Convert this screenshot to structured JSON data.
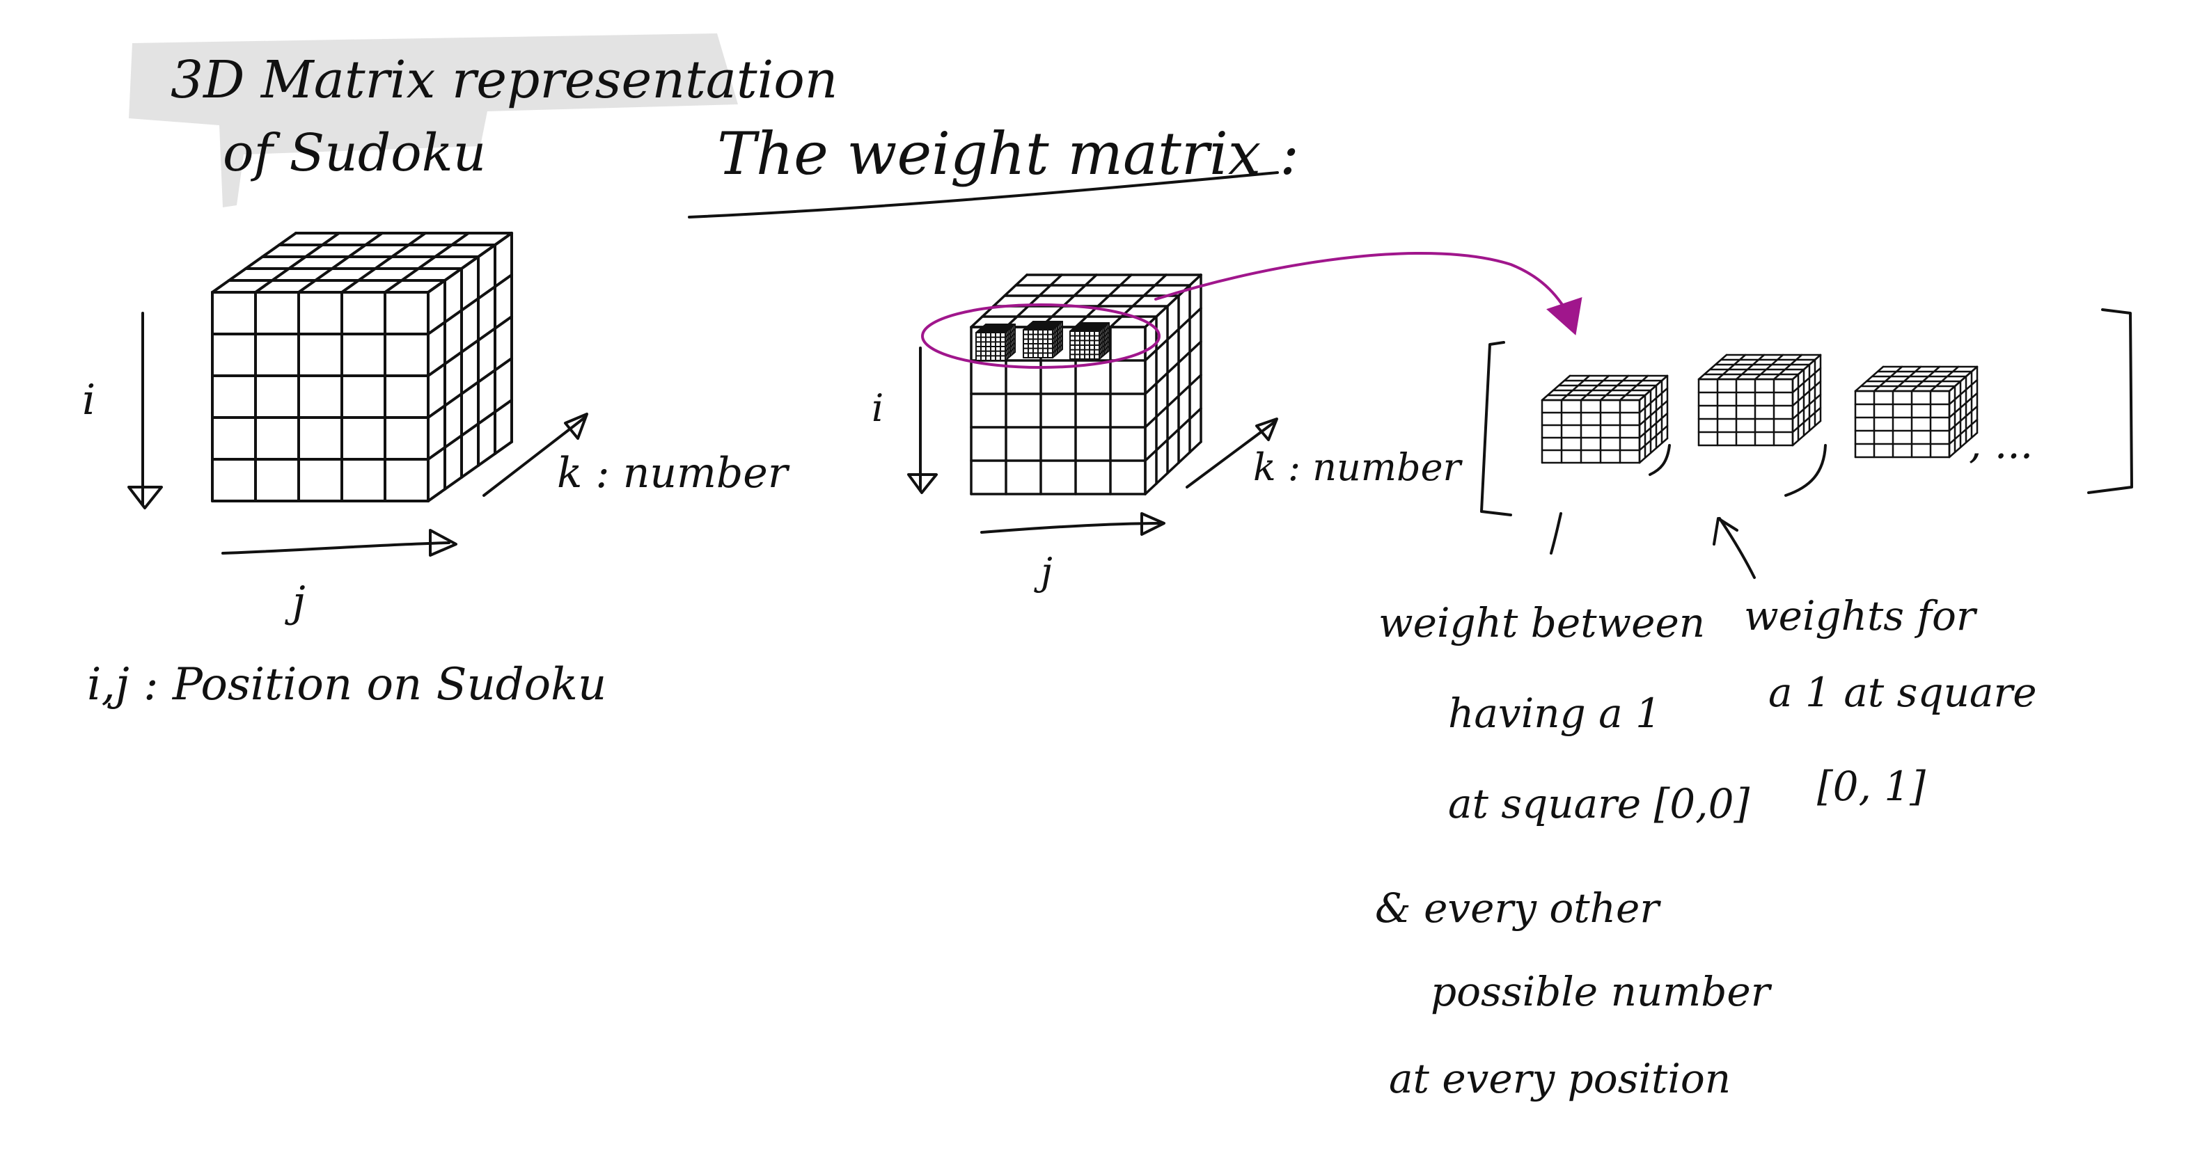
{
  "titles": {
    "sudoku_representation": [
      "3D Matrix representation",
      "of Sudoku"
    ],
    "weight_matrix": "The weight matrix :"
  },
  "axes": {
    "i": "i",
    "j": "j",
    "k": "k : number"
  },
  "position_note": "i,j : Position on Sudoku",
  "matrix_list": {
    "ellipsis": ", ..."
  },
  "annotations": {
    "weight_between": [
      "weight between",
      "having a 1",
      "at square [0,0]",
      "& every other",
      "possible number",
      "at every position"
    ],
    "weights_for": [
      "weights for",
      "a 1 at square",
      "[0, 1]"
    ]
  },
  "colors": {
    "ink": "#111111",
    "highlight": "#a0168c",
    "title_box": "#e3e3e3"
  }
}
